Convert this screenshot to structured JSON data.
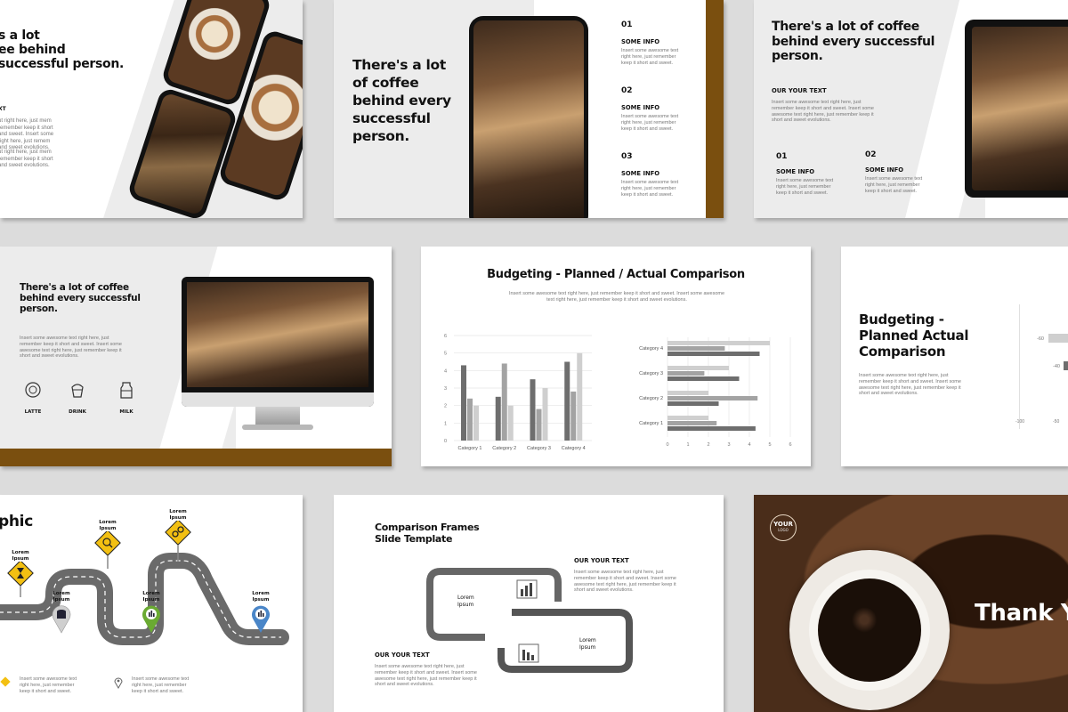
{
  "slide1": {
    "title_lines": [
      "There's a lot",
      "of coffee behind",
      "successful person."
    ],
    "title_partial": [
      "s a lot",
      "ee behind",
      "successful person."
    ],
    "subhead": "XT",
    "body1": "ut right here, just mem\nremember keep it short\nand sweet. Insert some\nright here, just remem\nand sweet evolutions.",
    "body2": "ut right here, just mem\nremember keep it short\nand sweet evolutions."
  },
  "slide2": {
    "title": "There's a lot of coffee behind every successful person.",
    "items": [
      {
        "num": "01",
        "label": "SOME INFO",
        "text": "Insert some awesome text right here, just remember keep it short and sweet."
      },
      {
        "num": "02",
        "label": "SOME INFO",
        "text": "Insert some awesome text right here, just remember keep it short and sweet."
      },
      {
        "num": "03",
        "label": "SOME INFO",
        "text": "Insert some awesome text right here, just remember keep it short and sweet."
      }
    ]
  },
  "slide3": {
    "title": "There's a lot of coffee behind every successful person.",
    "subhead": "OUR YOUR TEXT",
    "body": "Insert some awesome text right here, just remember keep it short and sweet. Insert some awesome text right here, just remember keep it short and sweet evolutions.",
    "items": [
      {
        "num": "01",
        "label": "SOME INFO",
        "text": "Insert some awesome text right here, just remember keep it short and sweet."
      },
      {
        "num": "02",
        "label": "SOME INFO",
        "text": "Insert some awesome text right here, just remember keep it short and sweet."
      }
    ]
  },
  "slide4": {
    "title": "There's a lot of coffee behind every successful person.",
    "body": "Insert some awesome text right here, just remember keep it short and sweet. Insert some awesome text right here, just remember keep it short and sweet evolutions.",
    "icons": [
      {
        "icon": "latte-icon",
        "label": "LATTE"
      },
      {
        "icon": "drink-icon",
        "label": "DRINK"
      },
      {
        "icon": "milk-icon",
        "label": "MILK"
      }
    ]
  },
  "slide5": {
    "title": "Budgeting - Planned / Actual Comparison",
    "body": "Insert some awesome text right here, just remember keep it short and sweet. Insert some awesome text right here, just remember keep it short and sweet evolutions."
  },
  "slide6": {
    "title": "Budgeting - Planned  Actual Comparison",
    "body": "Insert some awesome text right here, just remember keep it short and sweet. Insert some awesome text right here, just remember keep it short and sweet evolutions.",
    "chart_ticks_y": [
      "-60",
      "-40"
    ],
    "chart_ticks_x": [
      "-100",
      "-50"
    ]
  },
  "slide7": {
    "title_partial": "phic",
    "markers": [
      {
        "label": "Lorem\nIpsum",
        "icon": "hourglass-icon"
      },
      {
        "label": "Lorem\nIpsum",
        "icon": "database-icon"
      },
      {
        "label": "Lorem\nIpsum",
        "icon": "search-money-icon"
      },
      {
        "label": "Lorem\nIpsum",
        "icon": "chart-icon"
      },
      {
        "label": "Lorem\nIpsum",
        "icon": "gears-icon"
      },
      {
        "label": "Lorem\nIpsum",
        "icon": "bar-chart-icon"
      }
    ],
    "caption1": "Insert some awesome text right here, just remember keep it short and sweet.",
    "caption2": "Insert some awesome text right here, just remember keep it short and sweet."
  },
  "slide8": {
    "title": "Comparison Frames Slide Template",
    "top_head": "OUR YOUR TEXT",
    "top_body": "Insert some awesome text right here, just remember keep it short and sweet. Insert some awesome text right here, just remember keep it short and sweet evolutions.",
    "bottom_head": "OUR YOUR TEXT",
    "bottom_body": "Insert some awesome text right here, just remember keep it short and sweet. Insert some awesome text right here, just remember keep it short and sweet evolutions.",
    "frame1_label": "Lorem\nIpsum",
    "frame2_label": "Lorem\nIpsum"
  },
  "slide9": {
    "logo_line1": "YOUR",
    "logo_line2": "LOGO",
    "thanks": "Thank Y"
  },
  "chart_data": [
    {
      "type": "bar",
      "categories": [
        "Category 1",
        "Category 2",
        "Category 3",
        "Category 4"
      ],
      "series": [
        {
          "values": [
            4.3,
            2.5,
            3.5,
            4.5
          ]
        },
        {
          "values": [
            2.4,
            4.4,
            1.8,
            2.8
          ]
        },
        {
          "values": [
            2.0,
            2.0,
            3.0,
            5.0
          ]
        }
      ],
      "ylim": [
        0,
        6
      ],
      "yticks": [
        0,
        1,
        2,
        3,
        4,
        5,
        6
      ],
      "colors": [
        "#6e6e6e",
        "#a3a3a3",
        "#cfcfcf"
      ]
    },
    {
      "type": "bar",
      "orientation": "horizontal",
      "categories": [
        "Category 1",
        "Category 2",
        "Category 3",
        "Category 4"
      ],
      "series": [
        {
          "values": [
            4.3,
            2.5,
            3.5,
            4.5
          ]
        },
        {
          "values": [
            2.4,
            4.4,
            1.8,
            2.8
          ]
        },
        {
          "values": [
            2.0,
            2.0,
            3.0,
            5.0
          ]
        }
      ],
      "xlim": [
        0,
        6
      ],
      "xticks": [
        0,
        1,
        2,
        3,
        4,
        5,
        6
      ],
      "colors": [
        "#6e6e6e",
        "#a3a3a3",
        "#cfcfcf"
      ]
    }
  ]
}
